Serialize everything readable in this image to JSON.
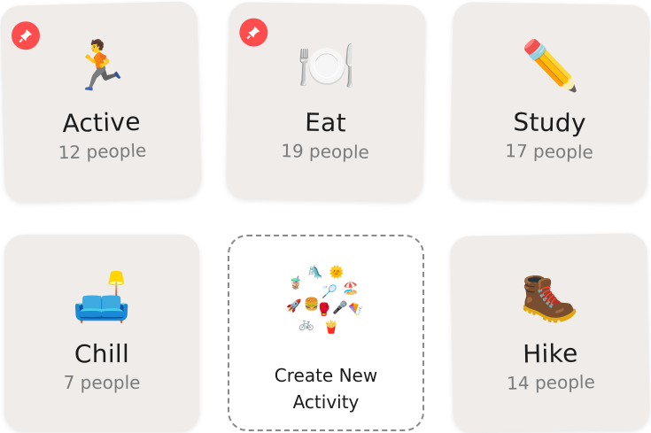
{
  "cards": [
    {
      "title": "Active",
      "count": "12 people",
      "icon": "runner-icon",
      "emoji": "🏃",
      "pinned": true
    },
    {
      "title": "Eat",
      "count": "19 people",
      "icon": "plate-cutlery-icon",
      "emoji": "🍽️",
      "pinned": true
    },
    {
      "title": "Study",
      "count": "17 people",
      "icon": "pencil-icon",
      "emoji": "✏️",
      "pinned": false
    },
    {
      "title": "Chill",
      "count": "7 people",
      "icon": "couch-lamp-icon",
      "emoji": "🛋️",
      "pinned": false
    },
    {
      "title": "Hike",
      "count": "14 people",
      "icon": "hiking-boot-icon",
      "emoji": "🥾",
      "pinned": false
    }
  ],
  "create": {
    "label": "Create New Activity",
    "icon": "activities-collage-icon",
    "collage": [
      "🧋",
      "🛝",
      "🌞",
      "🏸",
      "🏖️",
      "🚀",
      "🍔",
      "🎤",
      "🪁",
      "🚲",
      "🍟",
      "🥊"
    ]
  },
  "colors": {
    "card_bg": "#efecea",
    "pin": "#ff4d4d",
    "title": "#1b1b1b",
    "count": "#7b7b7b",
    "dash": "#8a8a8a"
  }
}
